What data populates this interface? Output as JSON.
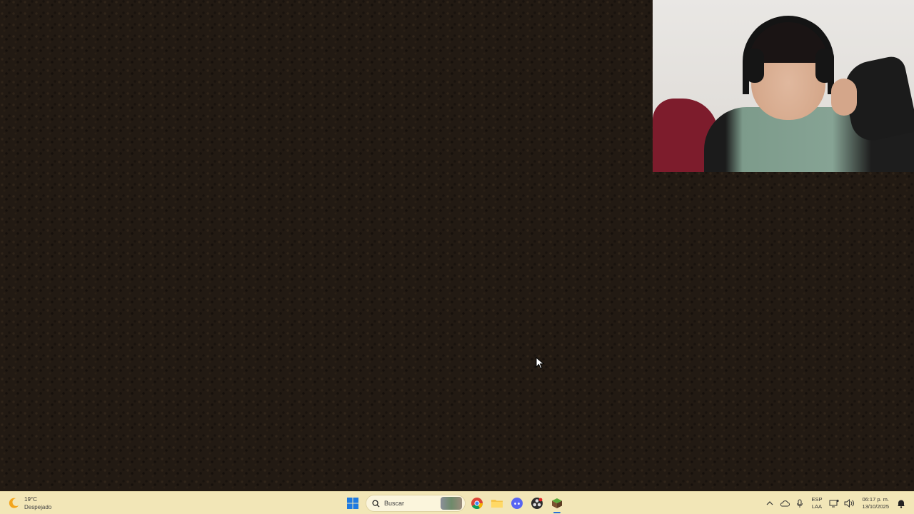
{
  "weather": {
    "temp": "19°C",
    "condition": "Despejado"
  },
  "search": {
    "placeholder": "Buscar"
  },
  "tray": {
    "lang_primary": "ESP",
    "lang_secondary": "LAA"
  },
  "clock": {
    "time": "06:17 p. m.",
    "date": "13/10/2025"
  },
  "taskbar_icons": [
    "windows-start-icon",
    "search-icon",
    "chrome-icon",
    "file-explorer-icon",
    "discord-icon",
    "obs-icon",
    "minecraft-icon"
  ],
  "colors": {
    "taskbar_bg": "#f2e6b7",
    "dirt_bg": "#221a13",
    "accent": "#2a6fd6"
  }
}
